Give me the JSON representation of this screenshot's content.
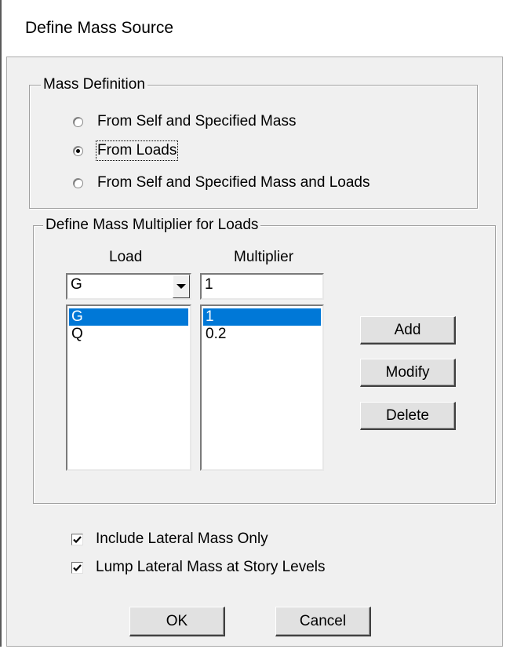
{
  "window": {
    "title": "Define Mass Source"
  },
  "mass_definition": {
    "legend": "Mass Definition",
    "options": [
      {
        "label": "From Self and Specified Mass",
        "checked": false
      },
      {
        "label": "From Loads",
        "checked": true
      },
      {
        "label": "From Self and Specified Mass and Loads",
        "checked": false
      }
    ]
  },
  "multiplier": {
    "legend": "Define Mass Multiplier for Loads",
    "load_header": "Load",
    "multiplier_header": "Multiplier",
    "load_dropdown_value": "G",
    "multiplier_input_value": "1",
    "loads": [
      "G",
      "Q"
    ],
    "multipliers": [
      "1",
      "0.2"
    ],
    "selected_index": 0,
    "buttons": {
      "add": "Add",
      "modify": "Modify",
      "delete": "Delete"
    }
  },
  "options": {
    "include_lateral": {
      "label": "Include Lateral Mass Only",
      "checked": true
    },
    "lump_lateral": {
      "label": "Lump Lateral Mass at Story Levels",
      "checked": true
    }
  },
  "footer": {
    "ok": "OK",
    "cancel": "Cancel"
  },
  "colors": {
    "selection": "#0078d7",
    "dialog_bg": "#f0f0f0"
  }
}
